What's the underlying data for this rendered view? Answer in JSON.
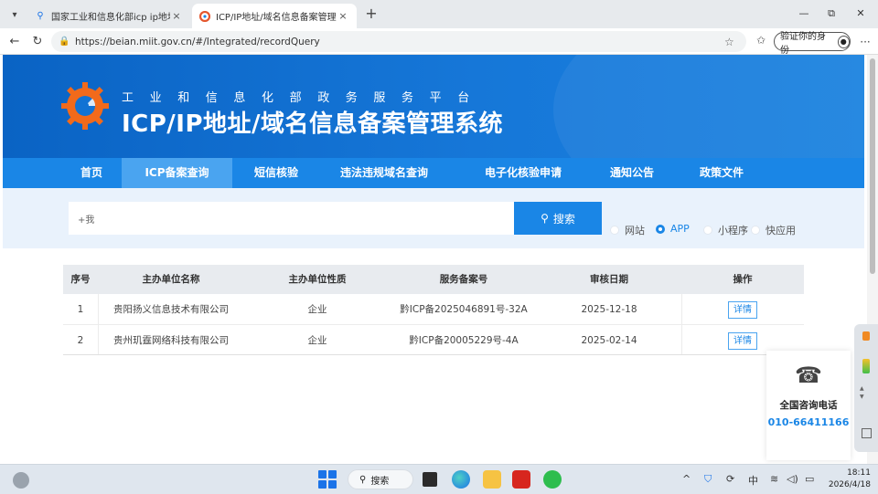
{
  "browser": {
    "tabs": [
      {
        "title": "国家工业和信息化部icp ip地址域名",
        "close": "×"
      },
      {
        "title": "ICP/IP地址/域名信息备案管理系统",
        "close": "×"
      }
    ],
    "new_tab": "+",
    "url": "https://beian.miit.gov.cn/#/Integrated/recordQuery",
    "verify_identity_label": "验证你的身份",
    "window_controls": [
      "—",
      "⧉",
      "✕"
    ]
  },
  "site": {
    "subtitle": "工业和信息化部政务服务平台",
    "title": "ICP/IP地址/域名信息备案管理系统",
    "nav": [
      {
        "label": "首页"
      },
      {
        "label": "ICP备案查询",
        "active": true
      },
      {
        "label": "短信核验"
      },
      {
        "label": "违法违规域名查询"
      },
      {
        "label": "电子化核验申请"
      },
      {
        "label": "通知公告"
      },
      {
        "label": "政策文件"
      }
    ]
  },
  "search": {
    "input_value": "+我",
    "button_label": "搜索",
    "types": [
      {
        "label": "网站",
        "checked": false
      },
      {
        "label": "APP",
        "checked": true
      },
      {
        "label": "小程序",
        "checked": false
      },
      {
        "label": "快应用",
        "checked": false
      }
    ]
  },
  "results": {
    "headers": [
      "序号",
      "主办单位名称",
      "主办单位性质",
      "服务备案号",
      "审核日期",
      "操作"
    ],
    "rows": [
      {
        "index": "1",
        "org_name": "贵阳扬义信息技术有限公司",
        "org_type": "企业",
        "record_no": "黔ICP备2025046891号-32A",
        "date": "2025-12-18",
        "action": "详情"
      },
      {
        "index": "2",
        "org_name": "贵州玑霆网络科技有限公司",
        "org_type": "企业",
        "record_no": "黔ICP备20005229号-4A",
        "date": "2025-02-14",
        "action": "详情"
      }
    ]
  },
  "hotline": {
    "title": "全国咨询电话",
    "number": "010-66411166"
  },
  "taskbar": {
    "search_label": "搜索",
    "ime": "中",
    "time": "18:11",
    "date": "2026/4/18"
  },
  "colors": {
    "brand_blue": "#1a86e6",
    "banner_dark": "#0a63c4",
    "active_nav": "#4aa4f0",
    "search_panel": "#e9f2fc"
  }
}
